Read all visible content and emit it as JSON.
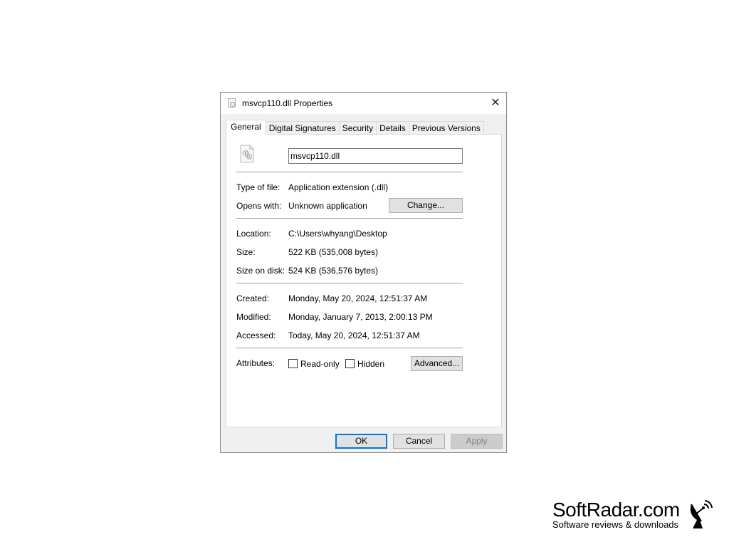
{
  "dialog": {
    "title": "msvcp110.dll Properties",
    "close_label": "✕",
    "tabs": [
      {
        "label": "General",
        "active": true
      },
      {
        "label": "Digital Signatures",
        "active": false
      },
      {
        "label": "Security",
        "active": false
      },
      {
        "label": "Details",
        "active": false
      },
      {
        "label": "Previous Versions",
        "active": false
      }
    ],
    "general": {
      "file_icon": "dll-gear-file-icon",
      "file_name": "msvcp110.dll",
      "type_label": "Type of file:",
      "type_value": "Application extension (.dll)",
      "opens_label": "Opens with:",
      "opens_value": "Unknown application",
      "change_button": "Change...",
      "location_label": "Location:",
      "location_value": "C:\\Users\\whyang\\Desktop",
      "size_label": "Size:",
      "size_value": "522 KB (535,008 bytes)",
      "size_disk_label": "Size on disk:",
      "size_disk_value": "524 KB (536,576 bytes)",
      "created_label": "Created:",
      "created_value": "Monday, May 20, 2024, 12:51:37 AM",
      "modified_label": "Modified:",
      "modified_value": "Monday, January 7, 2013, 2:00:13 PM",
      "accessed_label": "Accessed:",
      "accessed_value": "Today, May 20, 2024, 12:51:37 AM",
      "attributes_label": "Attributes:",
      "readonly_label": "Read-only",
      "readonly_checked": false,
      "hidden_label": "Hidden",
      "hidden_checked": false,
      "advanced_button": "Advanced..."
    },
    "footer": {
      "ok": "OK",
      "cancel": "Cancel",
      "apply": "Apply"
    },
    "accent_color": "#0078d7"
  },
  "watermark": {
    "name": "SoftRadar.com",
    "tagline": "Software reviews & downloads"
  }
}
